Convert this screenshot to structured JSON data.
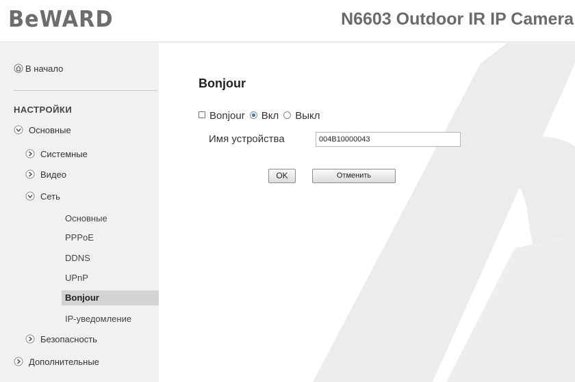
{
  "header": {
    "logo_text": "BeWARD",
    "camera_title": "N6603 Outdoor IR IP Camera"
  },
  "sidebar": {
    "home_label": "В начало",
    "section_label": "НАСТРОЙКИ",
    "groups": {
      "basic": "Основные",
      "system": "Системные",
      "video": "Видео",
      "network": "Сеть",
      "security": "Безопасность",
      "advanced": "Дополнительные"
    },
    "network_items": [
      "Основные",
      "PPPoE",
      "DDNS",
      "UPnP",
      "Bonjour",
      "IP-уведомление"
    ],
    "active_item": "Bonjour"
  },
  "content": {
    "title": "Bonjour",
    "bonjour_label": "Bonjour",
    "radio_on_label": "Вкл",
    "radio_off_label": "Выкл",
    "radio_selected": "Вкл",
    "device_name_label": "Имя устройства",
    "device_name_value": "004B10000043",
    "ok_label": "OK",
    "cancel_label": "Отменить"
  },
  "colors": {
    "sidebar_bg": "#f1f1f1",
    "active_item_bg": "#d3d3d3",
    "logo": "#6d6d6d",
    "watermark": "#ebebeb",
    "radio_dot": "#3b6fb6"
  }
}
